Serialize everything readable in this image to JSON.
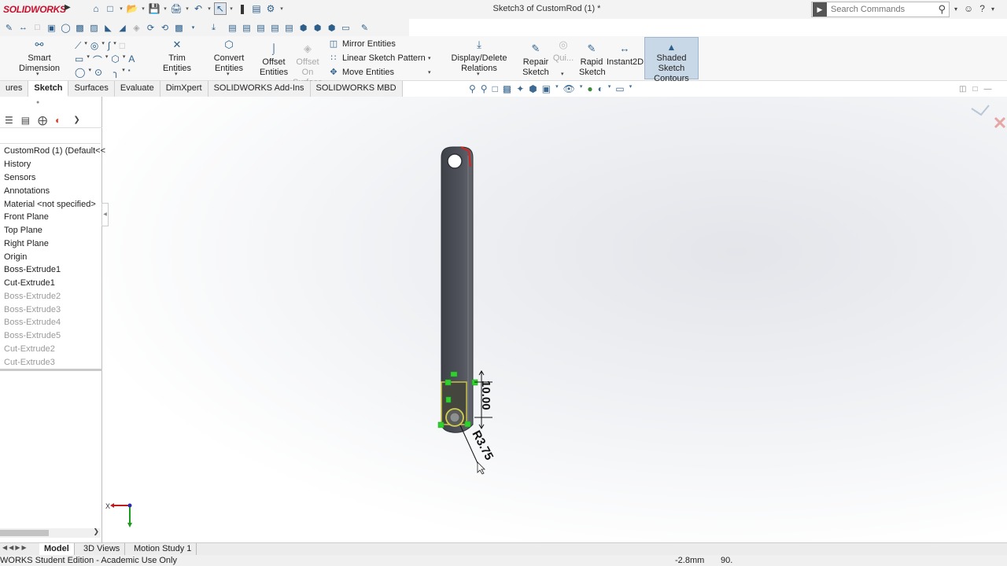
{
  "app": {
    "logo_text": "SOLIDWORKS",
    "doc_title": "Sketch3 of CustomRod (1) *",
    "search_placeholder": "Search Commands"
  },
  "command_manager": {
    "smart_dimension": "Smart Dimension",
    "trim_entities": "Trim Entities",
    "convert_entities": "Convert Entities",
    "offset_entities_1": "Offset",
    "offset_entities_2": "Entities",
    "offset_on_surface_1": "Offset On",
    "offset_on_surface_2": "Surface",
    "mirror_entities": "Mirror Entities",
    "linear_sketch_pattern": "Linear Sketch Pattern",
    "move_entities": "Move Entities",
    "display_delete_relations": "Display/Delete Relations",
    "repair_sketch_1": "Repair",
    "repair_sketch_2": "Sketch",
    "quick_snaps": "Qui...",
    "rapid_sketch_1": "Rapid",
    "rapid_sketch_2": "Sketch",
    "instant2d": "Instant2D",
    "shaded_contours_1": "Shaded Sketch",
    "shaded_contours_2": "Contours"
  },
  "tabs": [
    "ures",
    "Sketch",
    "Surfaces",
    "Evaluate",
    "DimXpert",
    "SOLIDWORKS Add-Ins",
    "SOLIDWORKS MBD"
  ],
  "feature_tree": {
    "root": "CustomRod (1)  (Default<<",
    "items": [
      {
        "label": "History",
        "suppressed": false
      },
      {
        "label": "Sensors",
        "suppressed": false
      },
      {
        "label": "Annotations",
        "suppressed": false
      },
      {
        "label": "Material <not specified>",
        "suppressed": false
      },
      {
        "label": "Front Plane",
        "suppressed": false
      },
      {
        "label": "Top Plane",
        "suppressed": false
      },
      {
        "label": "Right Plane",
        "suppressed": false
      },
      {
        "label": "Origin",
        "suppressed": false
      },
      {
        "label": "Boss-Extrude1",
        "suppressed": false
      },
      {
        "label": "Cut-Extrude1",
        "suppressed": false
      },
      {
        "label": "Boss-Extrude2",
        "suppressed": true
      },
      {
        "label": "Boss-Extrude3",
        "suppressed": true
      },
      {
        "label": "Boss-Extrude4",
        "suppressed": true
      },
      {
        "label": "Boss-Extrude5",
        "suppressed": true
      },
      {
        "label": "Cut-Extrude2",
        "suppressed": true
      },
      {
        "label": "Cut-Extrude3",
        "suppressed": true
      }
    ]
  },
  "sketch": {
    "dim_linear": "10.00",
    "dim_radius": "R3.75",
    "triad_x": "X"
  },
  "bottom_tabs": [
    "Model",
    "3D Views",
    "Motion Study 1"
  ],
  "status": {
    "edition": "WORKS Student Edition - Academic Use Only",
    "coord_x": "-2.8mm",
    "coord_y": "90."
  }
}
